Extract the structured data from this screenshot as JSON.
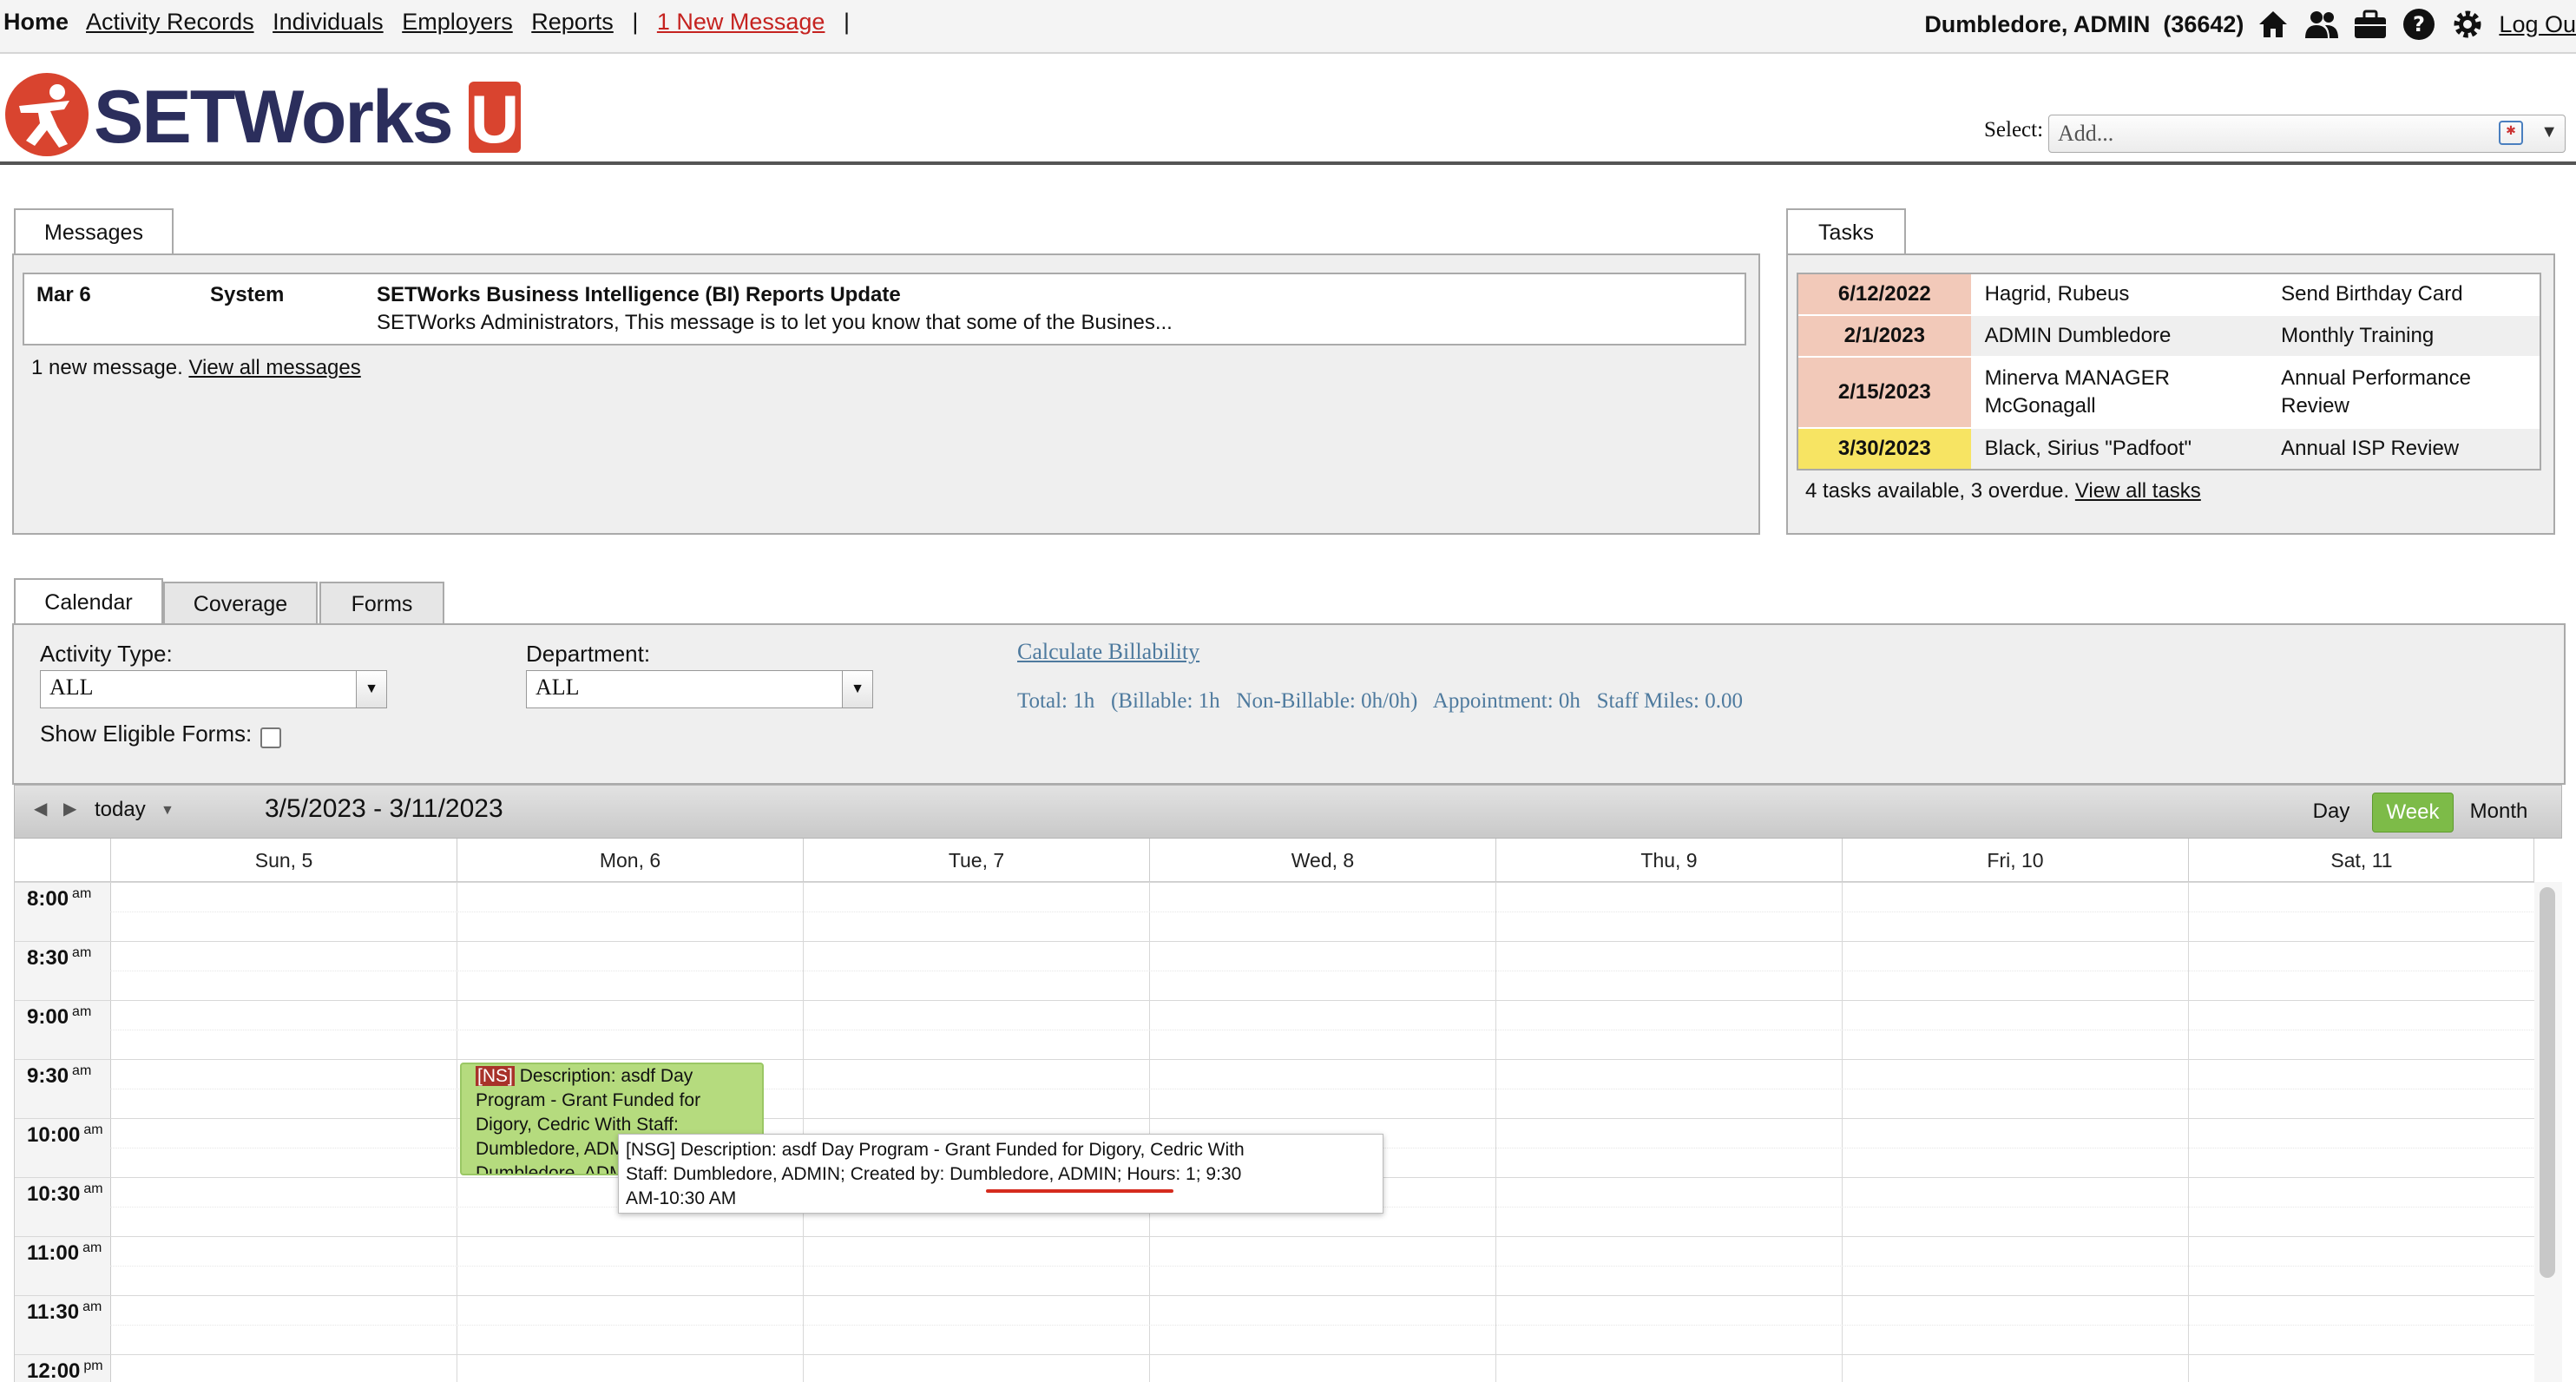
{
  "nav": {
    "home": "Home",
    "activity_records": "Activity Records",
    "individuals": "Individuals",
    "employers": "Employers",
    "reports": "Reports",
    "separator": "|",
    "new_message": "1 New Message",
    "user": "Dumbledore, ADMIN",
    "user_id": "(36642)",
    "logout": "Log Ou",
    "icons": [
      "home-icon",
      "users-icon",
      "briefcase-icon",
      "help-icon",
      "gear-icon"
    ]
  },
  "header": {
    "logo_text": "SETWorks",
    "logo_u": "U",
    "select_label": "Select:",
    "select_placeholder": "Add..."
  },
  "messages": {
    "tab": "Messages",
    "items": [
      {
        "date": "Mar 6",
        "from": "System",
        "subject": "SETWorks Business Intelligence (BI) Reports Update",
        "preview": "SETWorks Administrators, This message is to let you know that some of the Busines..."
      }
    ],
    "footer_text": "1 new message.",
    "footer_link": "View all messages"
  },
  "tasks": {
    "tab": "Tasks",
    "items": [
      {
        "date": "6/12/2022",
        "name": "Hagrid, Rubeus",
        "task": "Send Birthday Card",
        "color": "#f2c9b9"
      },
      {
        "date": "2/1/2023",
        "name": "ADMIN Dumbledore",
        "task": "Monthly Training",
        "color": "#f2c9b9"
      },
      {
        "date": "2/15/2023",
        "name": "Minerva MANAGER McGonagall",
        "task": "Annual Performance Review",
        "color": "#f2c9b9"
      },
      {
        "date": "3/30/2023",
        "name": "Black, Sirius \"Padfoot\"",
        "task": "Annual ISP Review",
        "color": "#f7e463"
      }
    ],
    "footer_text": "4 tasks available, 3 overdue.",
    "footer_link": "View all tasks"
  },
  "calendar_tabs": [
    "Calendar",
    "Coverage",
    "Forms"
  ],
  "filters": {
    "activity_type_label": "Activity Type:",
    "activity_type_value": "ALL",
    "department_label": "Department:",
    "department_value": "ALL",
    "show_eligible_label": "Show Eligible Forms:",
    "calc_link": "Calculate Billability",
    "summary": {
      "total": "Total: 1h",
      "billable": "(Billable: 1h",
      "non_billable": "Non-Billable: 0h/0h)",
      "appointment": "Appointment: 0h",
      "staff_miles": "Staff Miles: 0.00"
    }
  },
  "toolbar": {
    "today": "today",
    "range": "3/5/2023 - 3/11/2023",
    "views": [
      "Day",
      "Week",
      "Month"
    ],
    "active_view": "Week"
  },
  "days": [
    "Sun, 5",
    "Mon, 6",
    "Tue, 7",
    "Wed, 8",
    "Thu, 9",
    "Fri, 10",
    "Sat, 11"
  ],
  "times": [
    {
      "t": "8:00",
      "p": "am"
    },
    {
      "t": "8:30",
      "p": "am"
    },
    {
      "t": "9:00",
      "p": "am"
    },
    {
      "t": "9:30",
      "p": "am"
    },
    {
      "t": "10:00",
      "p": "am"
    },
    {
      "t": "10:30",
      "p": "am"
    },
    {
      "t": "11:00",
      "p": "am"
    },
    {
      "t": "11:30",
      "p": "am"
    },
    {
      "t": "12:00",
      "p": "pm"
    }
  ],
  "event": {
    "tag": "[NS]",
    "text": "Description: asdf Day Program - Grant Funded for Digory, Cedric With Staff: Dumbledore, ADMIN; Created by: Dumbledore, ADMIN; Hours: 1",
    "color": "#b5db7e"
  },
  "tooltip": {
    "line1": "[NSG] Description: asdf Day Program - Grant Funded for Digory, Cedric  With",
    "line2_pre": "Staff: Dumbledore, ADMIN; Created by: ",
    "line2_creator": "Dumbledore, ADMIN",
    "line2_post": "; Hours: 1; 9:30",
    "line3": "AM-10:30 AM"
  }
}
